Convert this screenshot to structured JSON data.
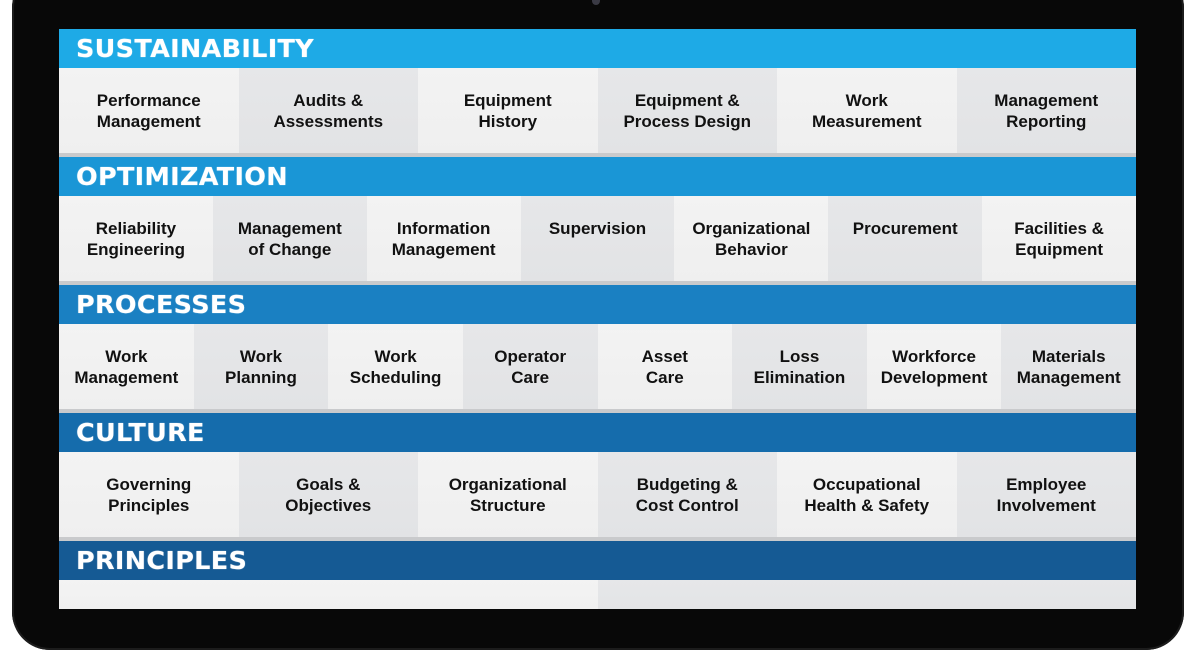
{
  "bands": [
    {
      "title": "SUSTAINABILITY",
      "color": "#1eaae6",
      "items": [
        "Performance\nManagement",
        "Audits &\nAssessments",
        "Equipment\nHistory",
        "Equipment &\nProcess Design",
        "Work\nMeasurement",
        "Management\nReporting"
      ]
    },
    {
      "title": "OPTIMIZATION",
      "color": "#1a96d6",
      "items": [
        "Reliability\nEngineering",
        "Management\nof Change",
        "Information\nManagement",
        "Supervision",
        "Organizational\nBehavior",
        "Procurement",
        "Facilities &\nEquipment"
      ]
    },
    {
      "title": "PROCESSES",
      "color": "#1a80c2",
      "items": [
        "Work\nManagement",
        "Work\nPlanning",
        "Work\nScheduling",
        "Operator\nCare",
        "Asset\nCare",
        "Loss\nElimination",
        "Workforce\nDevelopment",
        "Materials\nManagement"
      ]
    },
    {
      "title": "CULTURE",
      "color": "#156cac",
      "items": [
        "Governing\nPrinciples",
        "Goals &\nObjectives",
        "Organizational\nStructure",
        "Budgeting &\nCost Control",
        "Occupational\nHealth & Safety",
        "Employee\nInvolvement"
      ]
    },
    {
      "title": "PRINCIPLES",
      "color": "#155a94",
      "items": [
        "",
        ""
      ]
    }
  ]
}
